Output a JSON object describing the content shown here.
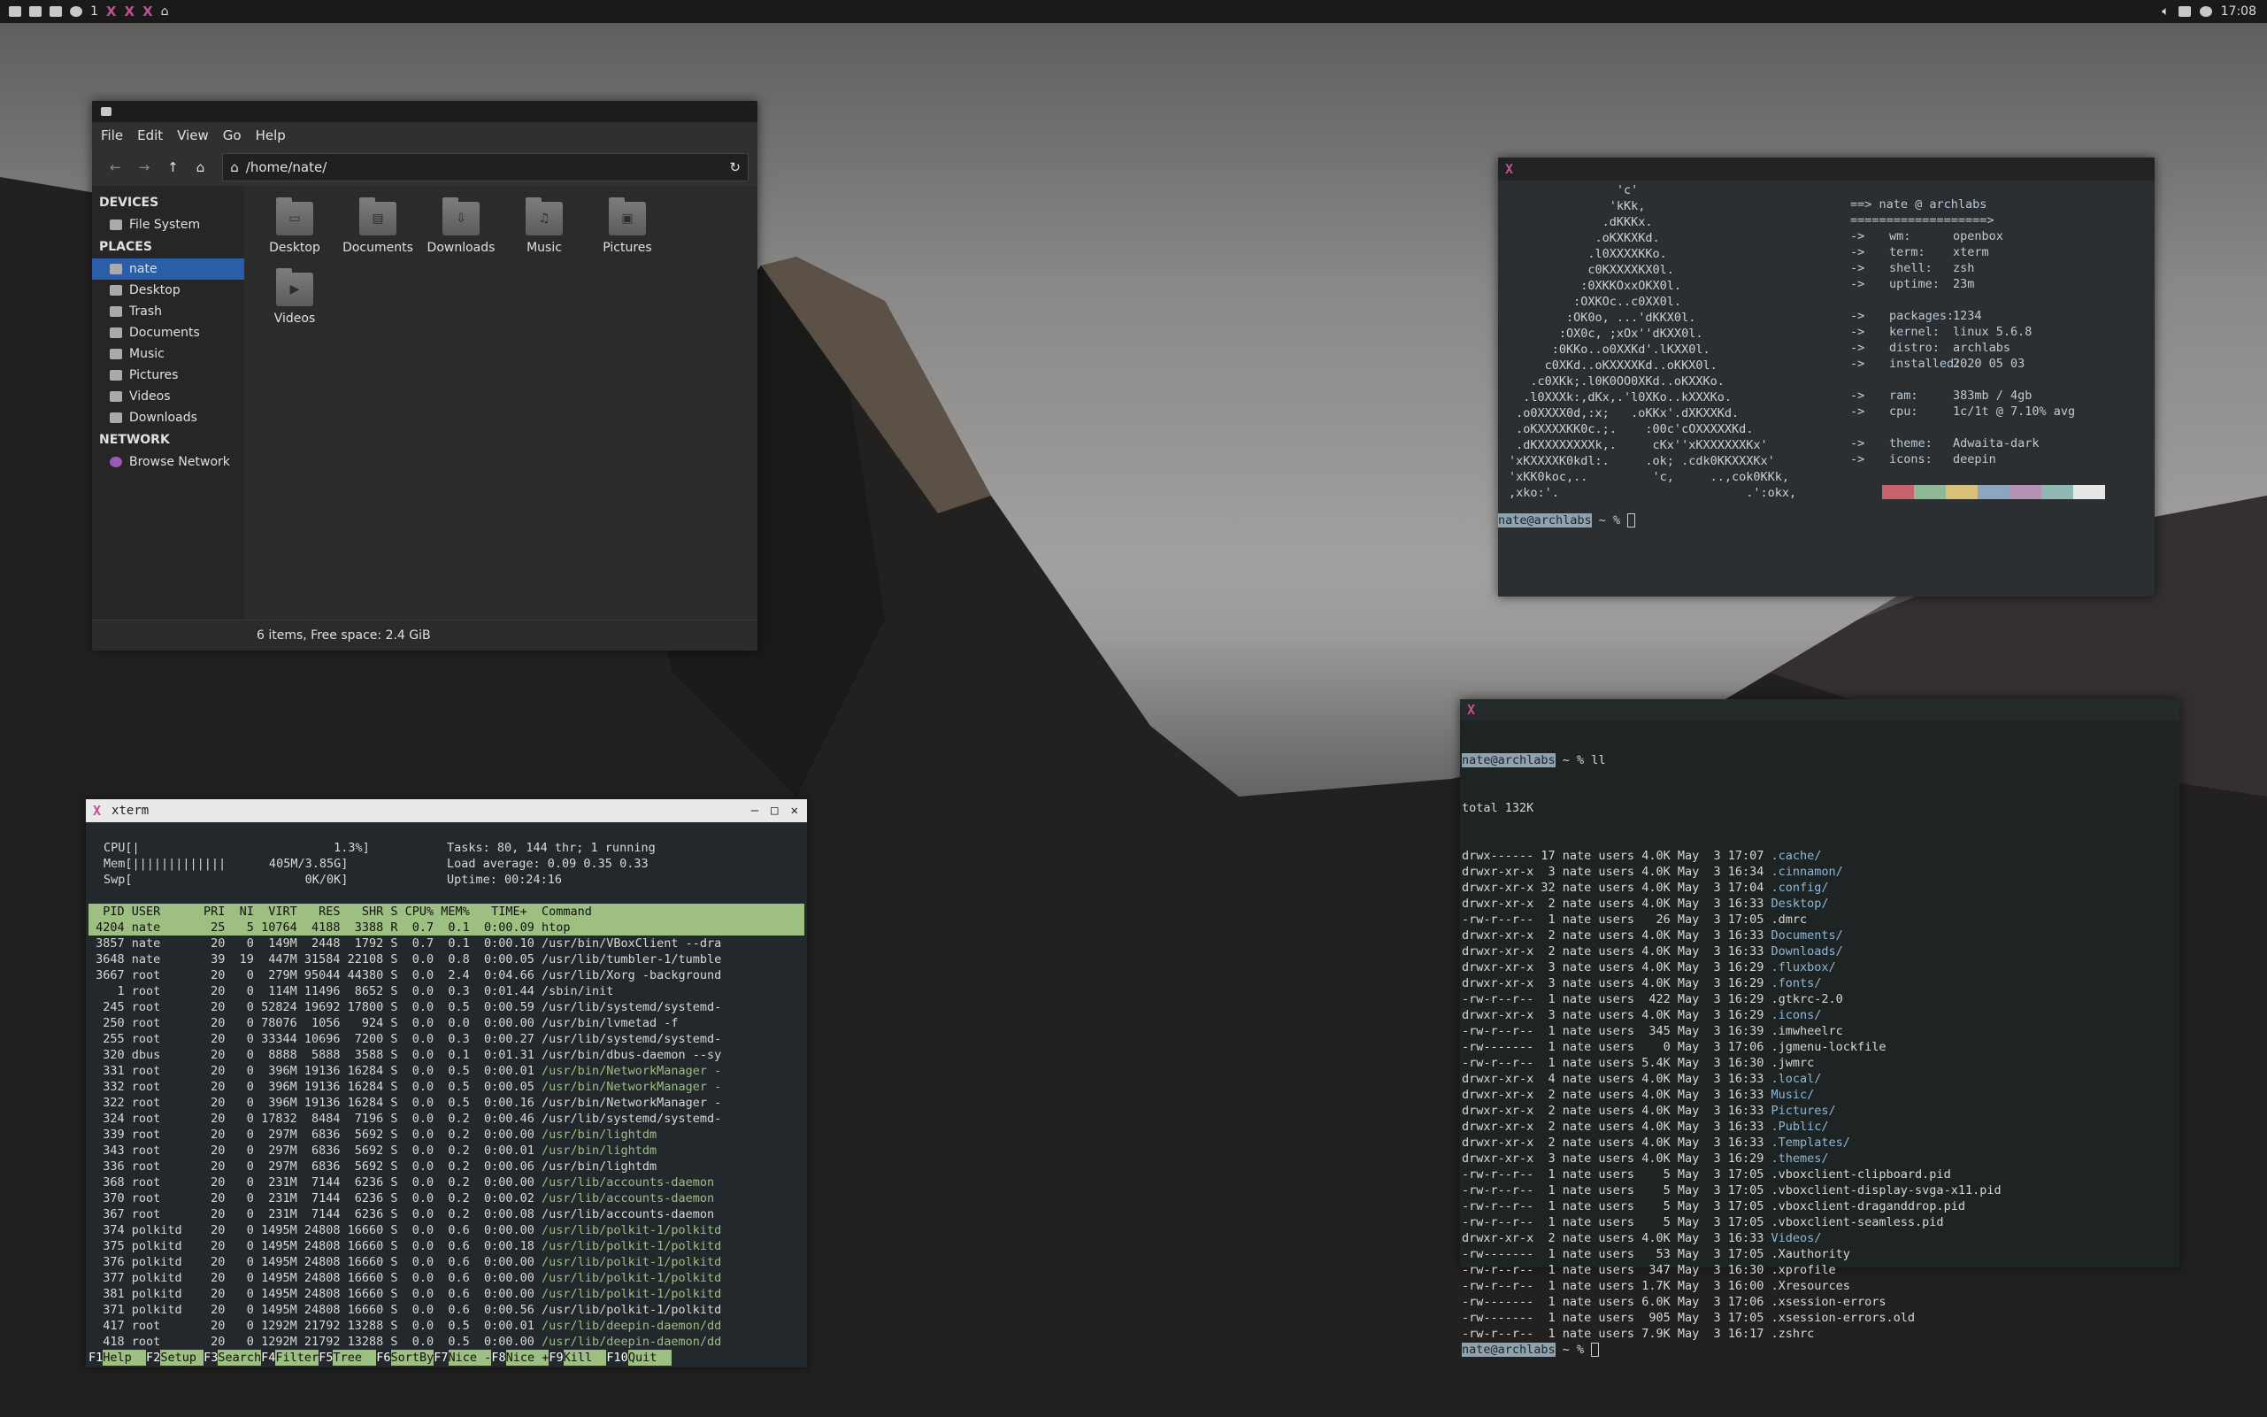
{
  "panel": {
    "workspace": "1",
    "clock": "17:08",
    "left_icons": [
      "launcher-icon",
      "terminal-icon",
      "files-icon",
      "browser-icon"
    ],
    "right_icons": [
      "volume-icon",
      "display-icon",
      "network-icon"
    ]
  },
  "file_manager": {
    "menu": [
      "File",
      "Edit",
      "View",
      "Go",
      "Help"
    ],
    "path": "/home/nate/",
    "sections": {
      "devices": "DEVICES",
      "places": "PLACES",
      "network": "NETWORK"
    },
    "devices": [
      {
        "label": "File System",
        "icon": "drive-icon"
      }
    ],
    "places": [
      {
        "label": "nate",
        "icon": "home-icon",
        "selected": true
      },
      {
        "label": "Desktop",
        "icon": "desktop-icon"
      },
      {
        "label": "Trash",
        "icon": "trash-icon"
      },
      {
        "label": "Documents",
        "icon": "documents-icon"
      },
      {
        "label": "Music",
        "icon": "music-icon"
      },
      {
        "label": "Pictures",
        "icon": "pictures-icon"
      },
      {
        "label": "Videos",
        "icon": "videos-icon"
      },
      {
        "label": "Downloads",
        "icon": "downloads-icon"
      }
    ],
    "network": [
      {
        "label": "Browse Network",
        "icon": "network-browse-icon"
      }
    ],
    "folders": [
      {
        "label": "Desktop",
        "glyph": "▭"
      },
      {
        "label": "Documents",
        "glyph": "▤"
      },
      {
        "label": "Downloads",
        "glyph": "⇩"
      },
      {
        "label": "Music",
        "glyph": "♫"
      },
      {
        "label": "Pictures",
        "glyph": "▣"
      },
      {
        "label": "Videos",
        "glyph": "▶"
      }
    ],
    "status": "6 items, Free space: 2.4 GiB"
  },
  "neofetch": {
    "art": [
      "               'c'",
      "              'kKk,",
      "             .dKKKx.",
      "            .oKXKXKd.",
      "           .l0XXXXKKo.",
      "           c0KXXXXKX0l.",
      "          :0XKKOxxOKX0l.",
      "         :OXKOc..c0XX0l.",
      "        :OK0o, ...'dKKX0l.",
      "       :OX0c, ;xOx''dKXX0l.",
      "      :0KKo..o0XXKd'.lKXX0l.",
      "     c0XKd..oKXXXXKd..oKKX0l.",
      "   .c0XKk;.l0K0OO0XKd..oKXXKo.",
      "  .l0XXXk:,dKx,.'l0XKo..kXXXKo.",
      " .o0XXXX0d,:x;   .oKKx'.dXKXXKd.",
      " .oKXXXXKK0c.;.    :00c'cOXXXXXKd.",
      " .dKXXXXXXXXk,.     cKx''xKXXXXXXKx'",
      "'xKXXXXK0kdl:.     .ok; .cdk0KKXXXKx'",
      "'xKK0koc,..         'c,     ..,cok0KKk,",
      ",xko:'.                          .':okx,"
    ],
    "info_title": "==> nate @ archlabs",
    "info_rule": "===================>",
    "info": [
      {
        "key": "wm:",
        "value": "openbox"
      },
      {
        "key": "term:",
        "value": "xterm"
      },
      {
        "key": "shell:",
        "value": "zsh"
      },
      {
        "key": "uptime:",
        "value": "23m"
      },
      {
        "key": "",
        "value": ""
      },
      {
        "key": "packages:",
        "value": "1234"
      },
      {
        "key": "kernel:",
        "value": "linux 5.6.8"
      },
      {
        "key": "distro:",
        "value": "archlabs"
      },
      {
        "key": "installed:",
        "value": "2020 05 03"
      },
      {
        "key": "",
        "value": ""
      },
      {
        "key": "ram:",
        "value": "383mb / 4gb"
      },
      {
        "key": "cpu:",
        "value": "1c/1t @ 7.10% avg"
      },
      {
        "key": "",
        "value": ""
      },
      {
        "key": "theme:",
        "value": "Adwaita-dark"
      },
      {
        "key": "icons:",
        "value": "deepin"
      }
    ],
    "palette": [
      "#2b2f31",
      "#c8636b",
      "#8fb896",
      "#d8c07a",
      "#8ea5c2",
      "#b58fb4",
      "#8fb8b3",
      "#e6e6e6"
    ],
    "prompt_user": "nate@archlabs",
    "prompt_rest": " ~ % "
  },
  "ls_term": {
    "prompt_user": "nate@archlabs",
    "command": " ~ % ll",
    "total": "total 132K",
    "entries": [
      {
        "meta": "drwx------ 17 nate users 4.0K May  3 17:07 ",
        "name": ".cache/",
        "dir": true
      },
      {
        "meta": "drwxr-xr-x  3 nate users 4.0K May  3 16:34 ",
        "name": ".cinnamon/",
        "dir": true
      },
      {
        "meta": "drwxr-xr-x 32 nate users 4.0K May  3 17:04 ",
        "name": ".config/",
        "dir": true
      },
      {
        "meta": "drwxr-xr-x  2 nate users 4.0K May  3 16:33 ",
        "name": "Desktop/",
        "dir": true
      },
      {
        "meta": "-rw-r--r--  1 nate users   26 May  3 17:05 ",
        "name": ".dmrc",
        "dir": false
      },
      {
        "meta": "drwxr-xr-x  2 nate users 4.0K May  3 16:33 ",
        "name": "Documents/",
        "dir": true
      },
      {
        "meta": "drwxr-xr-x  2 nate users 4.0K May  3 16:33 ",
        "name": "Downloads/",
        "dir": true
      },
      {
        "meta": "drwxr-xr-x  3 nate users 4.0K May  3 16:29 ",
        "name": ".fluxbox/",
        "dir": true
      },
      {
        "meta": "drwxr-xr-x  3 nate users 4.0K May  3 16:29 ",
        "name": ".fonts/",
        "dir": true
      },
      {
        "meta": "-rw-r--r--  1 nate users  422 May  3 16:29 ",
        "name": ".gtkrc-2.0",
        "dir": false
      },
      {
        "meta": "drwxr-xr-x  3 nate users 4.0K May  3 16:29 ",
        "name": ".icons/",
        "dir": true
      },
      {
        "meta": "-rw-r--r--  1 nate users  345 May  3 16:39 ",
        "name": ".imwheelrc",
        "dir": false
      },
      {
        "meta": "-rw-------  1 nate users    0 May  3 17:06 ",
        "name": ".jgmenu-lockfile",
        "dir": false
      },
      {
        "meta": "-rw-r--r--  1 nate users 5.4K May  3 16:30 ",
        "name": ".jwmrc",
        "dir": false
      },
      {
        "meta": "drwxr-xr-x  4 nate users 4.0K May  3 16:33 ",
        "name": ".local/",
        "dir": true
      },
      {
        "meta": "drwxr-xr-x  2 nate users 4.0K May  3 16:33 ",
        "name": "Music/",
        "dir": true
      },
      {
        "meta": "drwxr-xr-x  2 nate users 4.0K May  3 16:33 ",
        "name": "Pictures/",
        "dir": true
      },
      {
        "meta": "drwxr-xr-x  2 nate users 4.0K May  3 16:33 ",
        "name": ".Public/",
        "dir": true
      },
      {
        "meta": "drwxr-xr-x  2 nate users 4.0K May  3 16:33 ",
        "name": ".Templates/",
        "dir": true
      },
      {
        "meta": "drwxr-xr-x  3 nate users 4.0K May  3 16:29 ",
        "name": ".themes/",
        "dir": true
      },
      {
        "meta": "-rw-r--r--  1 nate users    5 May  3 17:05 ",
        "name": ".vboxclient-clipboard.pid",
        "dir": false
      },
      {
        "meta": "-rw-r--r--  1 nate users    5 May  3 17:05 ",
        "name": ".vboxclient-display-svga-x11.pid",
        "dir": false
      },
      {
        "meta": "-rw-r--r--  1 nate users    5 May  3 17:05 ",
        "name": ".vboxclient-draganddrop.pid",
        "dir": false
      },
      {
        "meta": "-rw-r--r--  1 nate users    5 May  3 17:05 ",
        "name": ".vboxclient-seamless.pid",
        "dir": false
      },
      {
        "meta": "drwxr-xr-x  2 nate users 4.0K May  3 16:33 ",
        "name": "Videos/",
        "dir": true
      },
      {
        "meta": "-rw-------  1 nate users   53 May  3 17:05 ",
        "name": ".Xauthority",
        "dir": false
      },
      {
        "meta": "-rw-r--r--  1 nate users  347 May  3 16:30 ",
        "name": ".xprofile",
        "dir": false
      },
      {
        "meta": "-rw-r--r--  1 nate users 1.7K May  3 16:00 ",
        "name": ".Xresources",
        "dir": false
      },
      {
        "meta": "-rw-------  1 nate users 6.0K May  3 17:06 ",
        "name": ".xsession-errors",
        "dir": false
      },
      {
        "meta": "-rw-------  1 nate users  905 May  3 17:05 ",
        "name": ".xsession-errors.old",
        "dir": false
      },
      {
        "meta": "-rw-r--r--  1 nate users 7.9K May  3 16:17 ",
        "name": ".zshrc",
        "dir": false
      }
    ],
    "prompt_rest": " ~ % "
  },
  "htop": {
    "title": "xterm",
    "meters": [
      "CPU[|                           1.3%]",
      "Mem[|||||||||||||      405M/3.85G]",
      "Swp[                        0K/0K]"
    ],
    "stats": [
      "Tasks: 80, 144 thr; 1 running",
      "Load average: 0.09 0.35 0.33",
      "Uptime: 00:24:16"
    ],
    "header": "  PID USER      PRI  NI  VIRT   RES   SHR S CPU% MEM%   TIME+  Command",
    "processes": [
      {
        "cols": " 4204 nate       25   5 10764  4188  3388 R  0.7  0.1  0:00.09 ",
        "cmd": "htop",
        "sel": true
      },
      {
        "cols": " 3857 nate       20   0  149M  2448  1792 S  0.7  0.1  0:00.10 ",
        "cmd": "/usr/bin/VBoxClient --dra"
      },
      {
        "cols": " 3648 nate       39  19  447M 31584 22108 S  0.0  0.8  0:00.05 ",
        "cmd": "/usr/lib/tumbler-1/tumble"
      },
      {
        "cols": " 3667 root       20   0  279M 95044 44380 S  0.0  2.4  0:04.66 ",
        "cmd": "/usr/lib/Xorg -background"
      },
      {
        "cols": "    1 root       20   0  114M 11496  8652 S  0.0  0.3  0:01.44 ",
        "cmd": "/sbin/init"
      },
      {
        "cols": "  245 root       20   0 52824 19692 17800 S  0.0  0.5  0:00.59 ",
        "cmd": "/usr/lib/systemd/systemd-"
      },
      {
        "cols": "  250 root       20   0 78076  1056   924 S  0.0  0.0  0:00.00 ",
        "cmd": "/usr/bin/lvmetad -f"
      },
      {
        "cols": "  255 root       20   0 33344 10696  7200 S  0.0  0.3  0:00.27 ",
        "cmd": "/usr/lib/systemd/systemd-"
      },
      {
        "cols": "  320 dbus       20   0  8888  5888  3588 S  0.0  0.1  0:01.31 ",
        "cmd": "/usr/bin/dbus-daemon --sy"
      },
      {
        "cols": "  331 root       20   0  396M 19136 16284 S  0.0  0.5  0:00.01 ",
        "cmd": "/usr/bin/NetworkManager -",
        "hl": true
      },
      {
        "cols": "  332 root       20   0  396M 19136 16284 S  0.0  0.5  0:00.05 ",
        "cmd": "/usr/bin/NetworkManager -",
        "hl": true
      },
      {
        "cols": "  322 root       20   0  396M 19136 16284 S  0.0  0.5  0:00.16 ",
        "cmd": "/usr/bin/NetworkManager -"
      },
      {
        "cols": "  324 root       20   0 17832  8484  7196 S  0.0  0.2  0:00.46 ",
        "cmd": "/usr/lib/systemd/systemd-"
      },
      {
        "cols": "  339 root       20   0  297M  6836  5692 S  0.0  0.2  0:00.00 ",
        "cmd": "/usr/bin/lightdm",
        "hl": true
      },
      {
        "cols": "  343 root       20   0  297M  6836  5692 S  0.0  0.2  0:00.01 ",
        "cmd": "/usr/bin/lightdm",
        "hl": true
      },
      {
        "cols": "  336 root       20   0  297M  6836  5692 S  0.0  0.2  0:00.06 ",
        "cmd": "/usr/bin/lightdm"
      },
      {
        "cols": "  368 root       20   0  231M  7144  6236 S  0.0  0.2  0:00.00 ",
        "cmd": "/usr/lib/accounts-daemon",
        "hl": true
      },
      {
        "cols": "  370 root       20   0  231M  7144  6236 S  0.0  0.2  0:00.02 ",
        "cmd": "/usr/lib/accounts-daemon",
        "hl": true
      },
      {
        "cols": "  367 root       20   0  231M  7144  6236 S  0.0  0.2  0:00.08 ",
        "cmd": "/usr/lib/accounts-daemon"
      },
      {
        "cols": "  374 polkitd    20   0 1495M 24808 16660 S  0.0  0.6  0:00.00 ",
        "cmd": "/usr/lib/polkit-1/polkitd",
        "hl": true
      },
      {
        "cols": "  375 polkitd    20   0 1495M 24808 16660 S  0.0  0.6  0:00.18 ",
        "cmd": "/usr/lib/polkit-1/polkitd",
        "hl": true
      },
      {
        "cols": "  376 polkitd    20   0 1495M 24808 16660 S  0.0  0.6  0:00.00 ",
        "cmd": "/usr/lib/polkit-1/polkitd",
        "hl": true
      },
      {
        "cols": "  377 polkitd    20   0 1495M 24808 16660 S  0.0  0.6  0:00.00 ",
        "cmd": "/usr/lib/polkit-1/polkitd",
        "hl": true
      },
      {
        "cols": "  381 polkitd    20   0 1495M 24808 16660 S  0.0  0.6  0:00.00 ",
        "cmd": "/usr/lib/polkit-1/polkitd",
        "hl": true
      },
      {
        "cols": "  371 polkitd    20   0 1495M 24808 16660 S  0.0  0.6  0:00.56 ",
        "cmd": "/usr/lib/polkit-1/polkitd"
      },
      {
        "cols": "  417 root       20   0 1292M 21792 13288 S  0.0  0.5  0:00.01 ",
        "cmd": "/usr/lib/deepin-daemon/dd",
        "hl": true
      },
      {
        "cols": "  418 root       20   0 1292M 21792 13288 S  0.0  0.5  0:00.00 ",
        "cmd": "/usr/lib/deepin-daemon/dd",
        "hl": true
      }
    ],
    "fkeys": [
      {
        "k": "F1",
        "l": "Help  "
      },
      {
        "k": "F2",
        "l": "Setup "
      },
      {
        "k": "F3",
        "l": "Search"
      },
      {
        "k": "F4",
        "l": "Filter"
      },
      {
        "k": "F5",
        "l": "Tree  "
      },
      {
        "k": "F6",
        "l": "SortBy"
      },
      {
        "k": "F7",
        "l": "Nice -"
      },
      {
        "k": "F8",
        "l": "Nice +"
      },
      {
        "k": "F9",
        "l": "Kill  "
      },
      {
        "k": "F10",
        "l": "Quit  "
      }
    ]
  }
}
